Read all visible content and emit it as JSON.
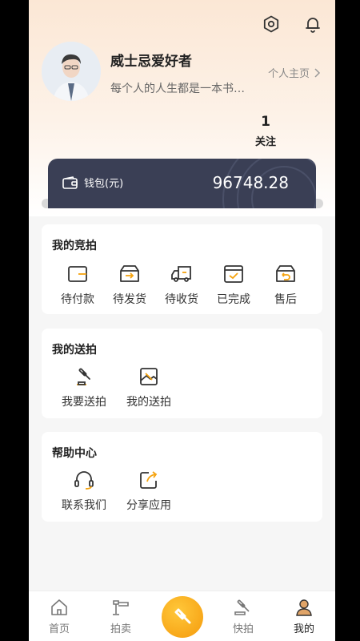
{
  "header": {
    "settings_icon": "settings-icon",
    "bell_icon": "bell-icon"
  },
  "profile": {
    "nickname": "威士忌爱好者",
    "signature": "每个人的人生都是一本书…",
    "home_link": "个人主页",
    "follow_count": "1",
    "follow_label": "关注"
  },
  "wallet": {
    "label": "钱包(元)",
    "amount": "96748.28"
  },
  "my_auction": {
    "title": "我的竞拍",
    "items": [
      {
        "label": "待付款",
        "icon": "pending-payment-icon"
      },
      {
        "label": "待发货",
        "icon": "pending-shipment-icon"
      },
      {
        "label": "待收货",
        "icon": "pending-receipt-icon"
      },
      {
        "label": "已完成",
        "icon": "completed-icon"
      },
      {
        "label": "售后",
        "icon": "after-sales-icon"
      }
    ]
  },
  "my_consign": {
    "title": "我的送拍",
    "items": [
      {
        "label": "我要送拍",
        "icon": "gavel-icon"
      },
      {
        "label": "我的送拍",
        "icon": "consign-image-icon"
      }
    ]
  },
  "help": {
    "title": "帮助中心",
    "items": [
      {
        "label": "联系我们",
        "icon": "headset-icon"
      },
      {
        "label": "分享应用",
        "icon": "share-icon"
      }
    ]
  },
  "tabbar": {
    "tabs": [
      {
        "label": "首页",
        "icon": "home-icon"
      },
      {
        "label": "拍卖",
        "icon": "auction-icon"
      },
      {
        "label": "",
        "icon": "center-gavel-icon"
      },
      {
        "label": "快拍",
        "icon": "quick-auction-icon"
      },
      {
        "label": "我的",
        "icon": "profile-icon"
      }
    ],
    "active_index": 4
  },
  "colors": {
    "accent": "#f5a30f",
    "wallet_bg": "#3a3f55",
    "header_gradient_top": "#fbe7d5"
  }
}
